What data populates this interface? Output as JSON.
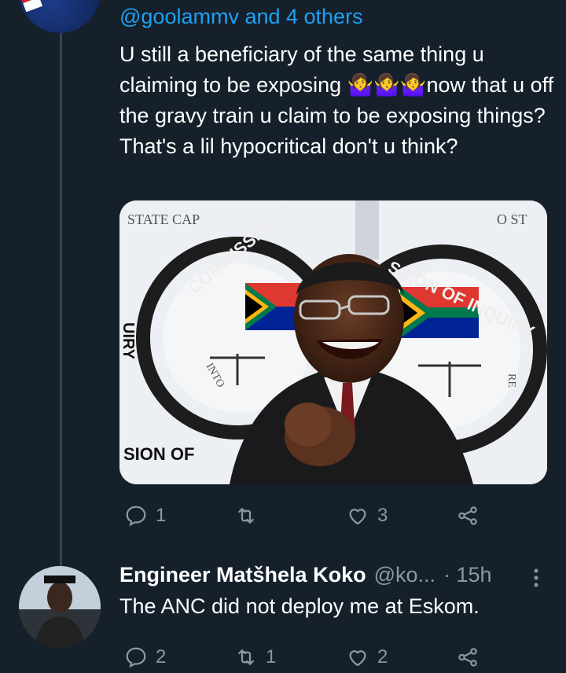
{
  "tweet": {
    "reply_to_label": "@goolammv and 4 others",
    "text": "U still a beneficiary of the same thing u claiming to be exposing 🤷‍♀️🤷‍♀️🤷‍♀️now that u off the gravy train u claim to be exposing things? That's a lil hypocritical don't u think?",
    "media": {
      "banner_texts": [
        "STATE CAP",
        "O ST",
        "COMMISSION O",
        "SSION OF INQUIRY",
        "UIRY",
        "SION OF",
        "INTO",
        "RE"
      ]
    },
    "actions": {
      "reply_count": "1",
      "retweet_count": "",
      "like_count": "3"
    }
  },
  "reply": {
    "name": "Engineer Matšhela Koko",
    "handle": "@ko...",
    "time": "· 15h",
    "text": "The ANC did not deploy me at Eskom.",
    "reply_count": "2",
    "retweet_count": "1",
    "like_count": "2"
  },
  "colors": {
    "background": "#15202b",
    "accent": "#1da1f2",
    "muted": "#8899a6",
    "thread_line": "#38444d"
  }
}
